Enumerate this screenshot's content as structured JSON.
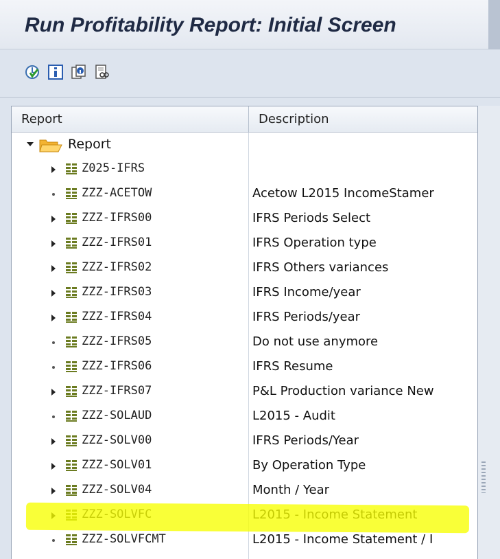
{
  "window": {
    "title": "Run Profitability Report: Initial Screen"
  },
  "toolbar": {
    "buttons": [
      {
        "name": "execute-icon"
      },
      {
        "name": "info-icon"
      },
      {
        "name": "copy-info-icon"
      },
      {
        "name": "display-icon"
      }
    ]
  },
  "grid": {
    "columns": [
      "Report",
      "Description"
    ],
    "root": {
      "label": "Report"
    },
    "rows": [
      {
        "code": "Z025-IFRS",
        "description": "",
        "expandable": true
      },
      {
        "code": "ZZZ-ACETOW",
        "description": "Acetow L2015 IncomeStamer",
        "expandable": false
      },
      {
        "code": "ZZZ-IFRS00",
        "description": "IFRS Periods Select",
        "expandable": true
      },
      {
        "code": "ZZZ-IFRS01",
        "description": "IFRS Operation type",
        "expandable": true
      },
      {
        "code": "ZZZ-IFRS02",
        "description": "IFRS Others variances",
        "expandable": true
      },
      {
        "code": "ZZZ-IFRS03",
        "description": "IFRS Income/year",
        "expandable": true
      },
      {
        "code": "ZZZ-IFRS04",
        "description": "IFRS Periods/year",
        "expandable": true
      },
      {
        "code": "ZZZ-IFRS05",
        "description": "Do not use anymore",
        "expandable": false
      },
      {
        "code": "ZZZ-IFRS06",
        "description": "IFRS Resume",
        "expandable": false
      },
      {
        "code": "ZZZ-IFRS07",
        "description": "P&L Production variance New",
        "expandable": true
      },
      {
        "code": "ZZZ-SOLAUD",
        "description": "L2015 - Audit",
        "expandable": false
      },
      {
        "code": "ZZZ-SOLV00",
        "description": "IFRS Periods/Year",
        "expandable": true
      },
      {
        "code": "ZZZ-SOLV01",
        "description": "By Operation Type",
        "expandable": true
      },
      {
        "code": "ZZZ-SOLV04",
        "description": "Month / Year",
        "expandable": true
      },
      {
        "code": "ZZZ-SOLVFC",
        "description": "L2015 - Income Statement",
        "expandable": true,
        "highlighted": true
      },
      {
        "code": "ZZZ-SOLVFCMT",
        "description": "L2015 - Income Statement / I",
        "expandable": false
      }
    ]
  },
  "colors": {
    "highlight": "#f7ff00",
    "folder": "#f5b323",
    "report_icon": "#6b7b20"
  }
}
